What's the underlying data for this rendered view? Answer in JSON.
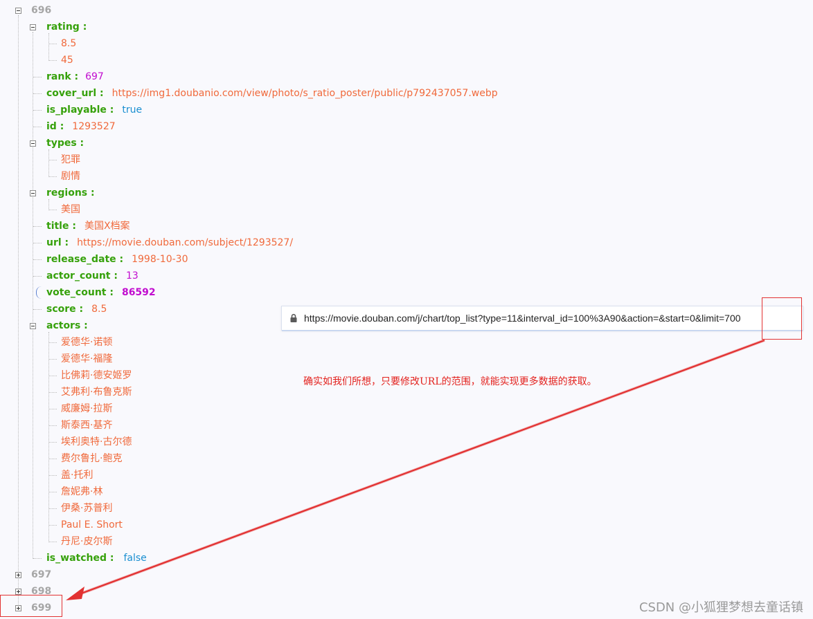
{
  "tree": {
    "node_696": "696",
    "rating_key": "rating :",
    "rating_items": [
      "8.5",
      "45"
    ],
    "rank_key": "rank :",
    "rank_val": "697",
    "cover_url_key": "cover_url :",
    "cover_url_val": "https://img1.doubanio.com/view/photo/s_ratio_poster/public/p792437057.webp",
    "is_playable_key": "is_playable :",
    "is_playable_val": "true",
    "id_key": "id :",
    "id_val": "1293527",
    "types_key": "types :",
    "types_items": [
      "犯罪",
      "剧情"
    ],
    "regions_key": "regions :",
    "regions_items": [
      "美国"
    ],
    "title_key": "title :",
    "title_val": "美国X档案",
    "url_key": "url :",
    "url_val": "https://movie.douban.com/subject/1293527/",
    "release_date_key": "release_date :",
    "release_date_val": "1998-10-30",
    "actor_count_key": "actor_count :",
    "actor_count_val": "13",
    "vote_count_key": "vote_count :",
    "vote_count_val": "86592",
    "score_key": "score :",
    "score_val": "8.5",
    "actors_key": "actors :",
    "actors_items": [
      "爱德华·诺顿",
      "爱德华·福隆",
      "比佛莉·德安姬罗",
      "艾弗利·布鲁克斯",
      "威廉姆·拉斯",
      "斯泰西·基齐",
      "埃利奥特·古尔德",
      "费尔鲁扎·鲍克",
      "盖·托利",
      "詹妮弗·林",
      "伊桑·苏普利",
      "Paul E. Short",
      "丹尼·皮尔斯"
    ],
    "is_watched_key": "is_watched :",
    "is_watched_val": "false",
    "node_697": "697",
    "node_698": "698",
    "node_699": "699"
  },
  "address_bar": {
    "url": "https://movie.douban.com/j/chart/top_list?type=11&interval_id=100%3A90&action=&start=0&limit=700",
    "icon": "lock-icon"
  },
  "annotation": {
    "note": "确实如我们所想，只要修改URL的范围，就能实现更多数据的获取。",
    "color": "#e3211d"
  },
  "watermark": "CSDN @小狐狸梦想去童话镇",
  "colors": {
    "key": "#36a10b",
    "string": "#f0693b",
    "number": "#c10ccf",
    "boolean": "#1a8fd1",
    "index": "#a6a6a6"
  }
}
